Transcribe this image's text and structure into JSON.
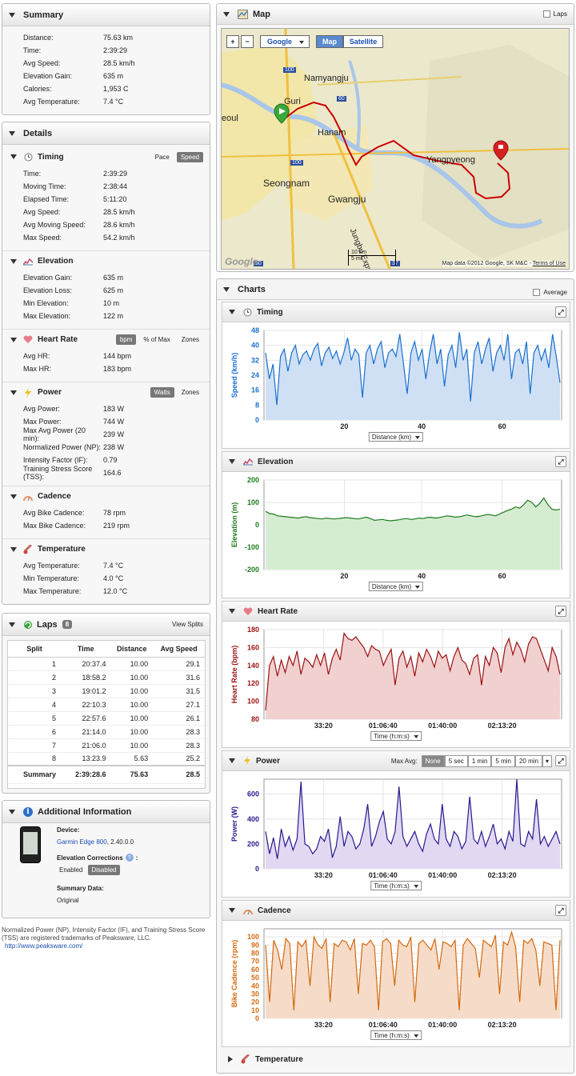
{
  "summary": {
    "title": "Summary",
    "rows": [
      {
        "k": "Distance:",
        "v": "75.63 km"
      },
      {
        "k": "Time:",
        "v": "2:39:29"
      },
      {
        "k": "Avg Speed:",
        "v": "28.5 km/h"
      },
      {
        "k": "Elevation Gain:",
        "v": "635 m"
      },
      {
        "k": "Calories:",
        "v": "1,953 C"
      },
      {
        "k": "Avg Temperature:",
        "v": "7.4 °C"
      }
    ]
  },
  "details": {
    "title": "Details",
    "timing": {
      "title": "Timing",
      "pace": "Pace",
      "speed": "Speed",
      "rows": [
        {
          "k": "Time:",
          "v": "2:39:29"
        },
        {
          "k": "Moving Time:",
          "v": "2:38:44"
        },
        {
          "k": "Elapsed Time:",
          "v": "5:11:20"
        },
        {
          "k": "Avg Speed:",
          "v": "28.5 km/h"
        },
        {
          "k": "Avg Moving Speed:",
          "v": "28.6 km/h"
        },
        {
          "k": "Max Speed:",
          "v": "54.2 km/h"
        }
      ]
    },
    "elevation": {
      "title": "Elevation",
      "rows": [
        {
          "k": "Elevation Gain:",
          "v": "635 m"
        },
        {
          "k": "Elevation Loss:",
          "v": "625 m"
        },
        {
          "k": "Min Elevation:",
          "v": "10 m"
        },
        {
          "k": "Max Elevation:",
          "v": "122 m"
        }
      ]
    },
    "heart_rate": {
      "title": "Heart Rate",
      "bpm": "bpm",
      "pct_max": "% of Max",
      "zones": "Zones",
      "rows": [
        {
          "k": "Avg HR:",
          "v": "144 bpm"
        },
        {
          "k": "Max HR:",
          "v": "183 bpm"
        }
      ]
    },
    "power": {
      "title": "Power",
      "watts": "Watts",
      "zones": "Zones",
      "rows": [
        {
          "k": "Avg Power:",
          "v": "183 W"
        },
        {
          "k": "Max Power:",
          "v": "744 W"
        },
        {
          "k": "Max Avg Power (20 min):",
          "v": "239 W"
        },
        {
          "k": "Normalized Power (NP):",
          "v": "238 W"
        },
        {
          "k": "Intensity Factor (IF):",
          "v": "0.79"
        },
        {
          "k": "Training Stress Score (TSS):",
          "v": "164.6"
        }
      ]
    },
    "cadence": {
      "title": "Cadence",
      "rows": [
        {
          "k": "Avg Bike Cadence:",
          "v": "78 rpm"
        },
        {
          "k": "Max Bike Cadence:",
          "v": "219 rpm"
        }
      ]
    },
    "temperature": {
      "title": "Temperature",
      "rows": [
        {
          "k": "Avg Temperature:",
          "v": "7.4 °C"
        },
        {
          "k": "Min Temperature:",
          "v": "4.0 °C"
        },
        {
          "k": "Max Temperature:",
          "v": "12.0 °C"
        }
      ]
    }
  },
  "laps": {
    "title": "Laps",
    "count": "8",
    "view_splits": "View Splits",
    "headers": [
      "Split",
      "Time",
      "Distance",
      "Avg Speed"
    ],
    "rows": [
      [
        "1",
        "20:37.4",
        "10.00",
        "29.1"
      ],
      [
        "2",
        "18:58.2",
        "10.00",
        "31.6"
      ],
      [
        "3",
        "19:01.2",
        "10.00",
        "31.5"
      ],
      [
        "4",
        "22:10.3",
        "10.00",
        "27.1"
      ],
      [
        "5",
        "22:57.6",
        "10.00",
        "26.1"
      ],
      [
        "6",
        "21:14.0",
        "10.00",
        "28.3"
      ],
      [
        "7",
        "21:06.0",
        "10.00",
        "28.3"
      ],
      [
        "8",
        "13:23.9",
        "5.63",
        "25.2"
      ]
    ],
    "summary": [
      "Summary",
      "2:39:28.6",
      "75.63",
      "28.5"
    ]
  },
  "additional": {
    "title": "Additional Information",
    "device_label": "Device:",
    "device_link": "Garmin Edge 800",
    "device_version": ", 2.40.0.0",
    "elev_corr_label": "Elevation Corrections",
    "elev_corr_colon": ":",
    "enabled": "Enabled",
    "disabled": "Disabled",
    "summary_data_label": "Summary Data:",
    "summary_data_value": "Original"
  },
  "footnote": {
    "text": "Normalized Power (NP), Intensity Factor (IF), and Training Stress Score (TSS) are registered trademarks of Peaksware, LLC.",
    "link": "http://www.peaksware.com/"
  },
  "map": {
    "title": "Map",
    "laps_label": "Laps",
    "provider": "Google",
    "map_btn": "Map",
    "satellite_btn": "Satellite",
    "zoom_in": "+",
    "zoom_out": "−",
    "labels": [
      "Namyangju",
      "Guri",
      "Hanam",
      "Yangpyeong",
      "Seongnam",
      "Gwangju",
      "Jungbu Expy",
      "eoul"
    ],
    "scale_km": "10 km",
    "scale_mi": "5 mi",
    "attribution": "Map data ©2012 Google, SK M&C -",
    "terms": "Terms of Use",
    "google_logo": "Google",
    "road_shields": [
      "100",
      "60",
      "100",
      "37",
      "50"
    ],
    "colors": {
      "route": "#cc0000",
      "water": "#a9c6e8",
      "land": "#ece8cc"
    }
  },
  "charts": {
    "title": "Charts",
    "average_label": "Average",
    "max_avg_label": "Max Avg:",
    "max_avg_options": [
      "None",
      "5 sec",
      "1 min",
      "5 min",
      "20 min"
    ],
    "collapsed_title": "Temperature",
    "items": [
      {
        "title": "Timing",
        "icon": "clock-icon",
        "axis_select": "Distance (km)"
      },
      {
        "title": "Elevation",
        "icon": "elevation-icon",
        "axis_select": "Distance (km)"
      },
      {
        "title": "Heart Rate",
        "icon": "heart-icon",
        "axis_select": "Time (h:m:s)"
      },
      {
        "title": "Power",
        "icon": "lightning-icon",
        "axis_select": "Time (h:m:s)"
      },
      {
        "title": "Cadence",
        "icon": "cadence-icon",
        "axis_select": "Time (h:m:s)"
      }
    ]
  },
  "chart_data": [
    {
      "type": "line",
      "title": "",
      "ylabel": "Speed (km/h)",
      "xlabel": "",
      "x_ticks": [
        "20",
        "40",
        "60"
      ],
      "x_range": [
        0,
        75.63
      ],
      "y_ticks": [
        0,
        8,
        16,
        24,
        32,
        40,
        48
      ],
      "ylim": [
        0,
        48
      ],
      "color": "#1a6fd0",
      "fill": "#cfe0f5",
      "values": [
        36,
        22,
        30,
        8,
        34,
        38,
        26,
        36,
        40,
        30,
        35,
        37,
        32,
        38,
        41,
        29,
        36,
        39,
        33,
        37,
        30,
        36,
        44,
        32,
        38,
        35,
        12,
        36,
        40,
        30,
        38,
        42,
        28,
        36,
        38,
        34,
        46,
        30,
        14,
        36,
        42,
        32,
        38,
        22,
        36,
        46,
        30,
        38,
        18,
        35,
        40,
        28,
        47,
        32,
        38,
        10,
        36,
        42,
        30,
        38,
        44,
        26,
        36,
        40,
        32,
        46,
        22,
        36,
        38,
        30,
        42,
        14,
        36,
        40,
        32,
        38,
        28,
        46,
        34,
        20
      ]
    },
    {
      "type": "line",
      "title": "",
      "ylabel": "Elevation (m)",
      "xlabel": "",
      "x_ticks": [
        "20",
        "40",
        "60"
      ],
      "x_range": [
        0,
        75.63
      ],
      "y_ticks": [
        -200,
        -100,
        0,
        100,
        200
      ],
      "ylim": [
        -200,
        200
      ],
      "color": "#1d7a1d",
      "fill": "#d6ecd2",
      "values": [
        60,
        50,
        48,
        40,
        38,
        36,
        34,
        32,
        30,
        34,
        36,
        32,
        30,
        28,
        26,
        30,
        28,
        26,
        28,
        30,
        32,
        30,
        28,
        26,
        30,
        34,
        28,
        20,
        22,
        24,
        20,
        18,
        20,
        22,
        26,
        28,
        24,
        26,
        30,
        28,
        32,
        34,
        30,
        32,
        36,
        40,
        38,
        34,
        36,
        40,
        44,
        40,
        36,
        38,
        42,
        46,
        44,
        40,
        48,
        56,
        64,
        70,
        80,
        74,
        90,
        110,
        100,
        80,
        96,
        120,
        90,
        70,
        66,
        70
      ]
    },
    {
      "type": "line",
      "title": "",
      "ylabel": "Heart Rate (bpm)",
      "xlabel": "",
      "x_ticks": [
        "33:20",
        "01:06:40",
        "01:40:00",
        "02:13:20"
      ],
      "x_range": [
        0,
        9569
      ],
      "y_ticks": [
        80,
        100,
        120,
        140,
        160,
        180
      ],
      "ylim": [
        80,
        180
      ],
      "color": "#9c1212",
      "fill": "#f1d0d0",
      "values": [
        90,
        140,
        150,
        128,
        146,
        132,
        150,
        140,
        156,
        130,
        148,
        144,
        138,
        152,
        140,
        154,
        130,
        148,
        158,
        146,
        176,
        170,
        168,
        172,
        166,
        160,
        150,
        162,
        158,
        156,
        140,
        150,
        158,
        118,
        148,
        156,
        138,
        150,
        128,
        154,
        144,
        158,
        150,
        138,
        156,
        148,
        152,
        134,
        150,
        160,
        146,
        142,
        130,
        148,
        152,
        118,
        150,
        140,
        160,
        154,
        132,
        160,
        170,
        152,
        166,
        158,
        144,
        164,
        172,
        170,
        158,
        146,
        134,
        160,
        150,
        130
      ]
    },
    {
      "type": "line",
      "title": "",
      "ylabel": "Power (W)",
      "xlabel": "",
      "x_ticks": [
        "33:20",
        "01:06:40",
        "01:40:00",
        "02:13:20"
      ],
      "x_range": [
        0,
        9569
      ],
      "y_ticks": [
        0,
        200,
        400,
        600
      ],
      "ylim": [
        0,
        720
      ],
      "color": "#2a1a90",
      "fill": "#e2d8f2",
      "values": [
        300,
        120,
        250,
        80,
        320,
        180,
        260,
        150,
        240,
        700,
        200,
        180,
        120,
        160,
        260,
        220,
        320,
        90,
        180,
        420,
        180,
        300,
        260,
        160,
        200,
        320,
        520,
        180,
        260,
        380,
        460,
        240,
        200,
        300,
        660,
        260,
        180,
        240,
        300,
        200,
        140,
        280,
        360,
        240,
        200,
        520,
        240,
        180,
        300,
        260,
        160,
        220,
        580,
        240,
        200,
        300,
        180,
        260,
        360,
        200,
        240,
        160,
        300,
        220,
        720,
        200,
        180,
        300,
        240,
        560,
        200,
        260,
        180,
        240,
        300,
        200
      ]
    },
    {
      "type": "line",
      "title": "",
      "ylabel": "Bike Cadence (rpm)",
      "xlabel": "",
      "x_ticks": [
        "33:20",
        "01:06:40",
        "01:40:00",
        "02:13:20"
      ],
      "x_range": [
        0,
        9569
      ],
      "y_ticks": [
        0,
        10,
        20,
        30,
        40,
        50,
        60,
        70,
        80,
        90,
        100
      ],
      "ylim": [
        0,
        110
      ],
      "color": "#d46a10",
      "fill": "#f6dcc8",
      "values": [
        90,
        20,
        96,
        84,
        60,
        98,
        92,
        10,
        94,
        88,
        96,
        40,
        100,
        90,
        86,
        98,
        20,
        92,
        88,
        96,
        94,
        84,
        98,
        30,
        92,
        90,
        96,
        88,
        10,
        94,
        98,
        92,
        40,
        96,
        90,
        88,
        100,
        20,
        92,
        96,
        90,
        84,
        98,
        60,
        94,
        92,
        88,
        96,
        10,
        90,
        98,
        92,
        86,
        50,
        96,
        92,
        88,
        102,
        30,
        94,
        90,
        106,
        88,
        20,
        96,
        92,
        98,
        84,
        40,
        94,
        92,
        90,
        10,
        96
      ]
    }
  ]
}
